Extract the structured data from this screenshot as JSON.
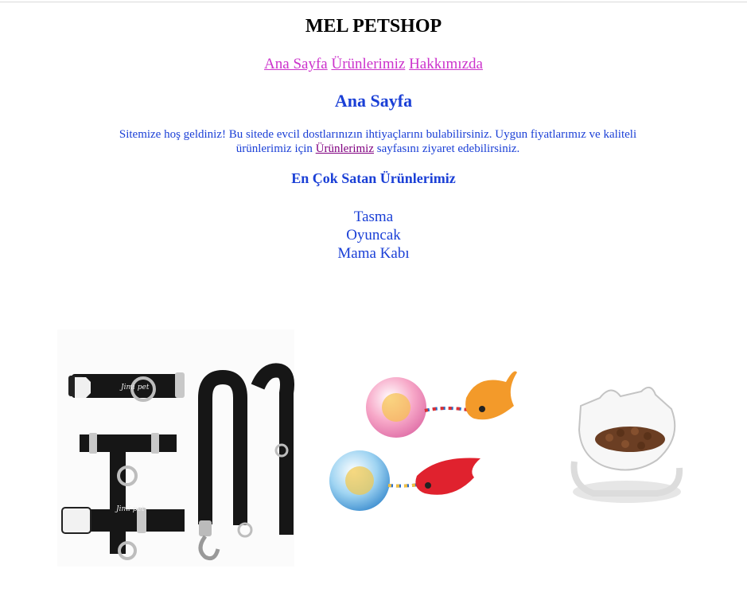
{
  "site": {
    "title": "MEL PETSHOP"
  },
  "nav": {
    "items": [
      {
        "label": "Ana Sayfa"
      },
      {
        "label": "Ürünlerimiz"
      },
      {
        "label": "Hakkımızda"
      }
    ],
    "link_color": "#cc33cc"
  },
  "main": {
    "heading": "Ana Sayfa",
    "intro_before": "Sitemize hoş geldiniz! Bu sitede evcil dostlarınızın ihtiyaçlarını bulabilirsiniz. Uygun fiyatlarımız ve kaliteli ürünlerimiz için ",
    "intro_link": "Ürünlerimiz",
    "intro_after": " sayfasını ziyaret edebilirsiniz.",
    "text_color": "#1a3fd6",
    "best_sellers": {
      "heading": "En Çok Satan Ürünlerimiz",
      "items": [
        "Tasma",
        "Oyuncak",
        "Mama Kabı"
      ]
    },
    "images": {
      "collar_brand": "Jimi pet"
    }
  }
}
